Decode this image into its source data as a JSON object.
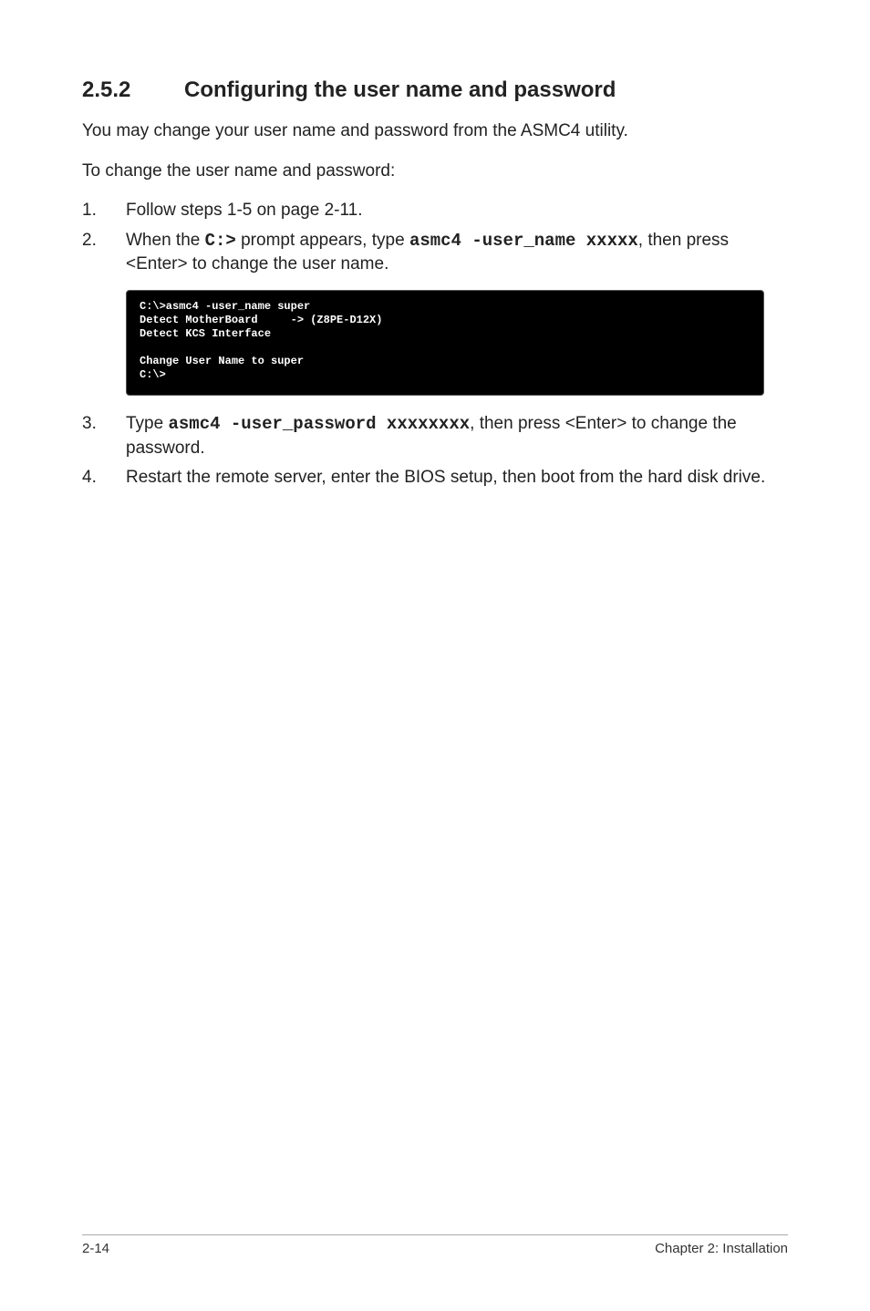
{
  "section": {
    "number": "2.5.2",
    "title": "Configuring the user name and password"
  },
  "intro1": "You may change your user name and password from the ASMC4 utility.",
  "intro2": "To change the user name and password:",
  "steps_a": [
    {
      "n": "1.",
      "text": "Follow steps 1-5 on page 2-11."
    },
    {
      "n": "2.",
      "pre": "When the ",
      "code1": "C:>",
      "mid1": " prompt appears, type ",
      "code2": "asmc4 -user_name xxxxx",
      "mid2": ", then press <Enter> to change the user name."
    }
  ],
  "terminal": "C:\\>asmc4 -user_name super\nDetect MotherBoard     -> (Z8PE-D12X)\nDetect KCS Interface\n\nChange User Name to super\nC:\\>",
  "steps_b": [
    {
      "n": "3.",
      "pre": "Type ",
      "code1": "asmc4 -user_password xxxxxxxx",
      "mid1": ", then press <Enter> to change the password."
    },
    {
      "n": "4.",
      "text": "Restart the remote server, enter the BIOS setup, then boot from the hard disk drive."
    }
  ],
  "footer": {
    "left": "2-14",
    "right": "Chapter 2: Installation"
  }
}
